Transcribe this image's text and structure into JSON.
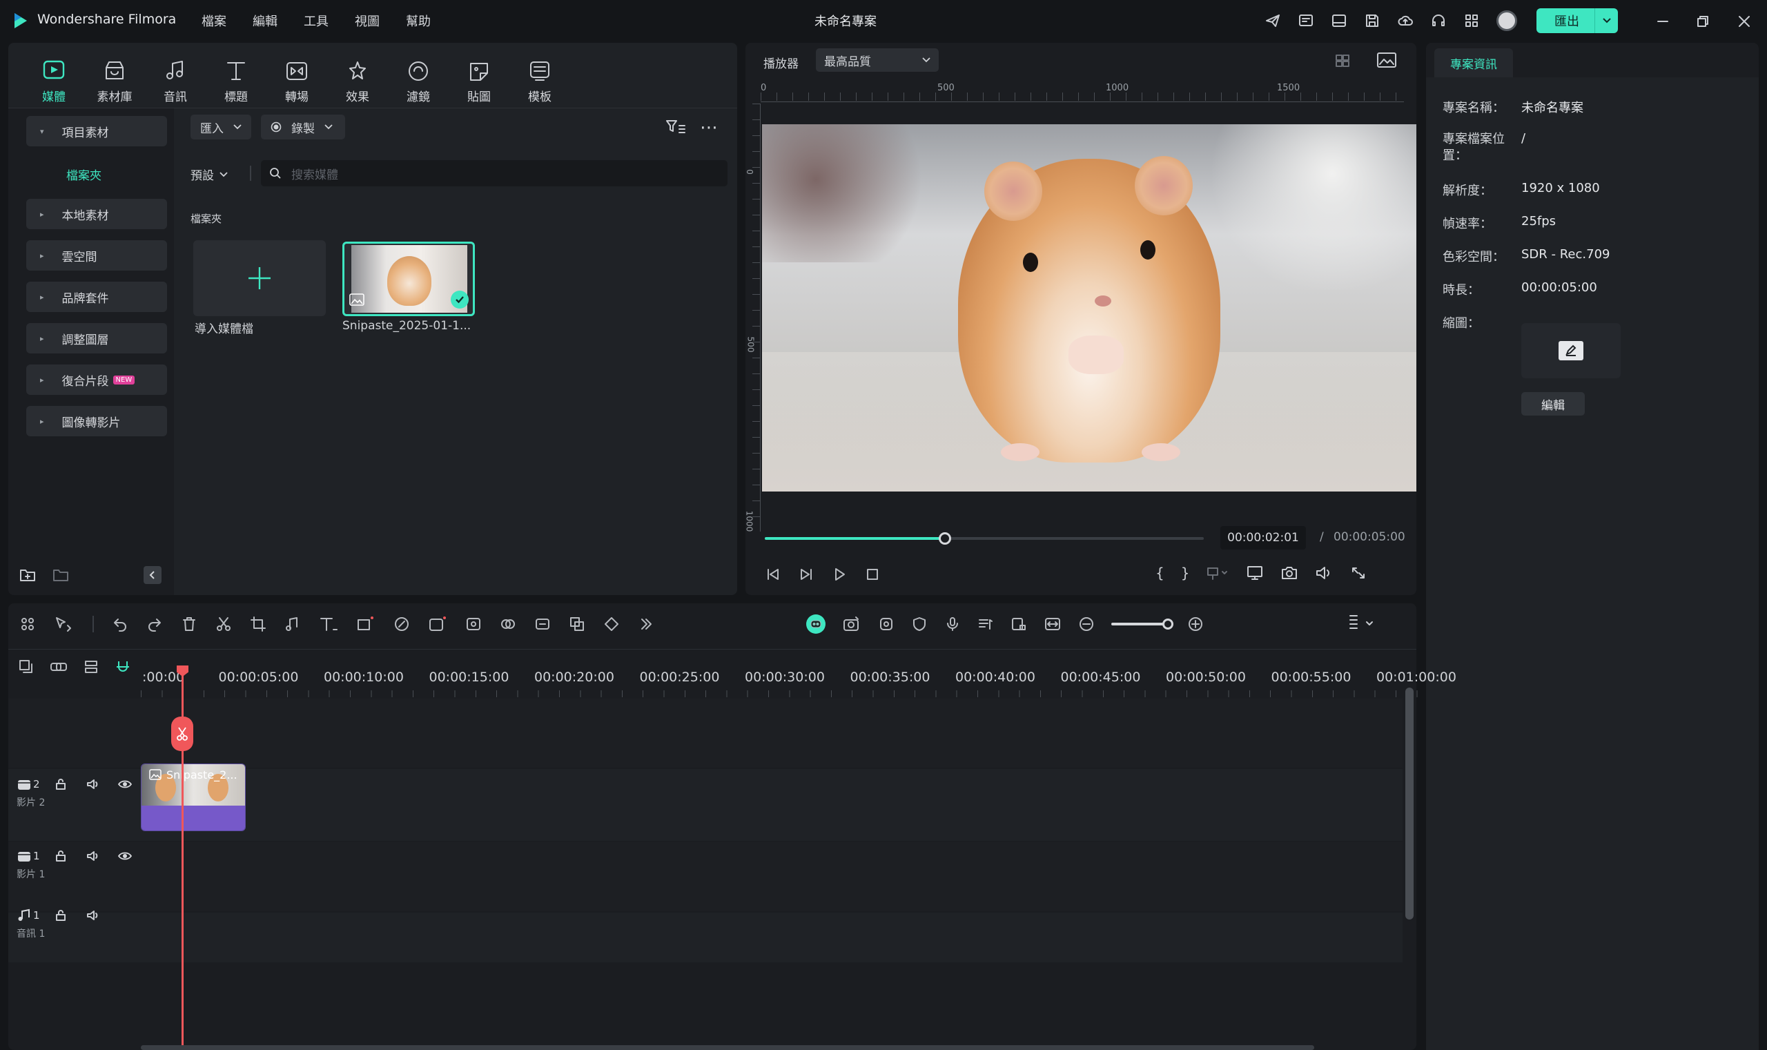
{
  "app": {
    "name": "Wondershare Filmora",
    "project_title": "未命名專案",
    "export_label": "匯出"
  },
  "menu": [
    "檔案",
    "編輯",
    "工具",
    "視圖",
    "幫助"
  ],
  "toolbar_tabs": [
    {
      "label": "媒體",
      "icon": "media-icon",
      "active": true
    },
    {
      "label": "素材庫",
      "icon": "stock-icon"
    },
    {
      "label": "音訊",
      "icon": "audio-icon"
    },
    {
      "label": "標題",
      "icon": "title-icon"
    },
    {
      "label": "轉場",
      "icon": "transition-icon"
    },
    {
      "label": "效果",
      "icon": "effects-icon"
    },
    {
      "label": "濾鏡",
      "icon": "filter-icon"
    },
    {
      "label": "貼圖",
      "icon": "sticker-icon"
    },
    {
      "label": "模板",
      "icon": "template-icon"
    }
  ],
  "sidebar": {
    "project_media": "項目素材",
    "folder": "檔案夾",
    "items": [
      {
        "label": "本地素材"
      },
      {
        "label": "雲空間"
      },
      {
        "label": "品牌套件"
      },
      {
        "label": "調整圖層"
      },
      {
        "label": "復合片段",
        "badge": "NEW"
      },
      {
        "label": "圖像轉影片"
      }
    ]
  },
  "media": {
    "import_label": "匯入",
    "record_label": "錄製",
    "sort_label": "預設",
    "search_placeholder": "搜索媒體",
    "folder_heading": "檔案夾",
    "import_tile_label": "導入媒體檔",
    "clip_label": "Snipaste_2025-01-1..."
  },
  "player": {
    "label": "播放器",
    "quality": "最高品質",
    "ruler_h": [
      "0",
      "500",
      "1000",
      "1500"
    ],
    "ruler_v": [
      "0",
      "500",
      "1000"
    ],
    "current_time": "00:00:02:01",
    "separator": "/",
    "total_time": "00:00:05:00",
    "progress": 0.41
  },
  "project_info": {
    "tab": "專案資訊",
    "rows": [
      {
        "label": "專案名稱：",
        "value": "未命名專案"
      },
      {
        "label": "專案檔案位置：",
        "value": "/"
      },
      {
        "label": "解析度：",
        "value": "1920 x 1080"
      },
      {
        "label": "幀速率：",
        "value": "25fps"
      },
      {
        "label": "色彩空間：",
        "value": "SDR - Rec.709"
      },
      {
        "label": "時長：",
        "value": "00:00:05:00"
      },
      {
        "label": "縮圖：",
        "value": ""
      }
    ],
    "edit_label": "編輯"
  },
  "timeline": {
    "ticks": [
      ":00:00",
      "00:00:05:00",
      "00:00:10:00",
      "00:00:15:00",
      "00:00:20:00",
      "00:00:25:00",
      "00:00:30:00",
      "00:00:35:00",
      "00:00:40:00",
      "00:00:45:00",
      "00:00:50:00",
      "00:00:55:00",
      "00:01:00:00"
    ],
    "tracks": [
      {
        "icon": "video-track-icon",
        "num": "2",
        "name": "影片 2"
      },
      {
        "icon": "video-track-icon",
        "num": "1",
        "name": "影片 1"
      },
      {
        "icon": "music-track-icon",
        "num": "1",
        "name": "音訊 1"
      }
    ],
    "clip_label": "Snipaste_2..."
  },
  "colors": {
    "accent": "#3ee6c1",
    "clip_purple": "#7659c9",
    "playhead": "#f0575a"
  }
}
